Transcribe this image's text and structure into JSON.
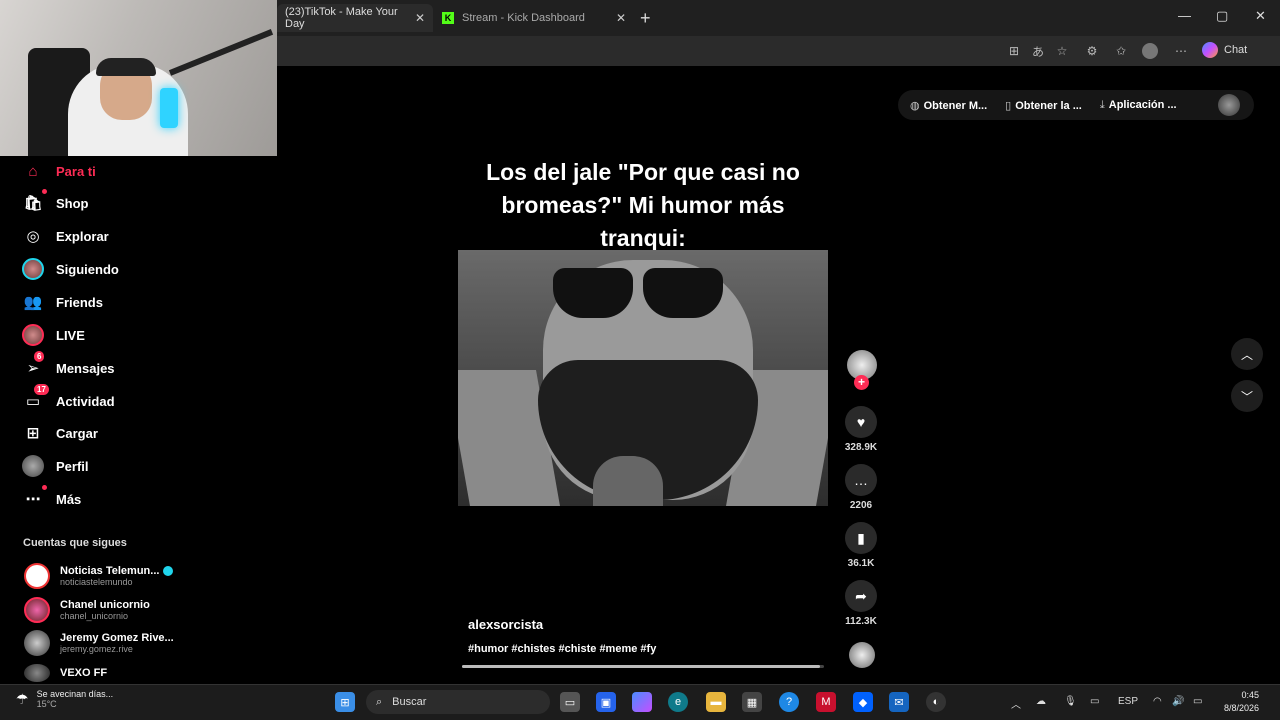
{
  "browser": {
    "tabs": [
      {
        "label": "(23)TikTok - Make Your Day",
        "active": true
      },
      {
        "label": "Stream - Kick Dashboard",
        "active": false
      }
    ],
    "new_tab": "+",
    "chat_label": "Chat",
    "window_controls": {
      "minimize": "—",
      "maximize": "▢",
      "close": "✕"
    }
  },
  "top_buttons": {
    "get_m": "Obtener M...",
    "get_la": "Obtener la ...",
    "app": "Aplicación ..."
  },
  "sidebar": {
    "items": [
      {
        "label": "Para ti",
        "icon": "home-icon",
        "active": true
      },
      {
        "label": "Shop",
        "icon": "shopping-bag-icon",
        "dot": true
      },
      {
        "label": "Explorar",
        "icon": "compass-icon"
      },
      {
        "label": "Siguiendo",
        "icon": "avatar-icon"
      },
      {
        "label": "Friends",
        "icon": "users-icon"
      },
      {
        "label": "LIVE",
        "icon": "live-avatar-icon"
      },
      {
        "label": "Mensajes",
        "icon": "send-icon",
        "badge": "6"
      },
      {
        "label": "Actividad",
        "icon": "inbox-icon",
        "badge": "17"
      },
      {
        "label": "Cargar",
        "icon": "plus-square-icon"
      },
      {
        "label": "Perfil",
        "icon": "profile-avatar-icon"
      },
      {
        "label": "Más",
        "icon": "more-icon",
        "dot": true
      }
    ],
    "following_title": "Cuentas que sigues",
    "accounts": [
      {
        "name": "Noticias Telemun...",
        "handle": "noticiastelemundo",
        "verified": true
      },
      {
        "name": "Chanel unicornio",
        "handle": "chanel_unicornio"
      },
      {
        "name": "Jeremy Gomez Rive...",
        "handle": "jeremy.gomez.rive"
      },
      {
        "name": "VEXO FF",
        "handle": ""
      }
    ]
  },
  "video": {
    "caption": "Los del jale \"Por que casi no bromeas?\" Mi humor más tranqui:",
    "author": "alexsorcista",
    "tags": "#humor #chistes #chiste #meme #fy",
    "progress": 0.99
  },
  "actions": {
    "likes": "328.9K",
    "comments": "2206",
    "saves": "36.1K",
    "shares": "112.3K"
  },
  "taskbar": {
    "weather_text": "Se avecinan días...",
    "temp": "15°C",
    "search": "Buscar",
    "lang": "ESP",
    "time": "0:45",
    "date": "8/8/2026"
  },
  "colors": {
    "accent": "#fe2c55",
    "verified": "#20d5ec"
  }
}
